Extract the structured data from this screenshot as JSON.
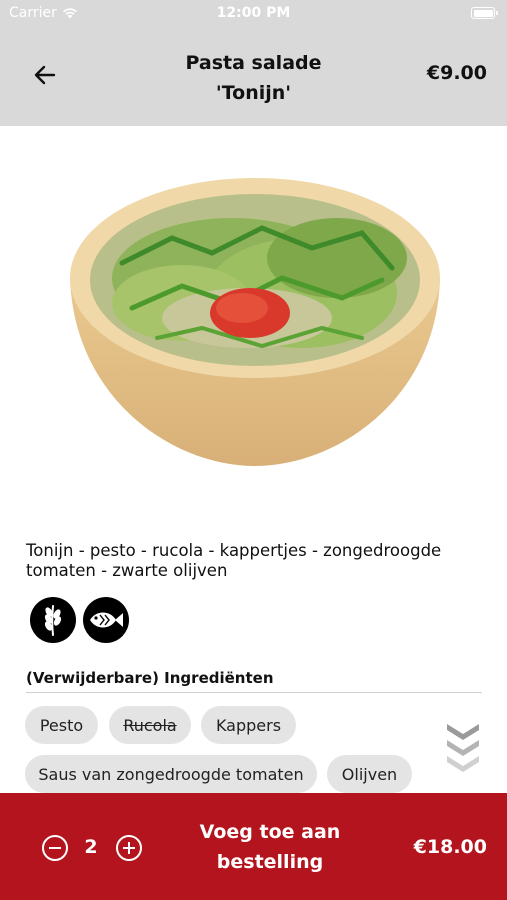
{
  "status_bar": {
    "carrier": "Carrier",
    "time": "12:00 PM"
  },
  "header": {
    "title_line1": "Pasta salade",
    "title_line2": "'Tonijn'",
    "price": "€9.00"
  },
  "product": {
    "description": "Tonijn - pesto - rucola - kappertjes - zongedroogde tomaten - zwarte olijven",
    "badges": [
      "wheat-icon",
      "fish-icon"
    ]
  },
  "ingredients": {
    "title": "(Verwijderbare) Ingrediënten",
    "items": [
      {
        "label": "Pesto",
        "removed": false
      },
      {
        "label": "Rucola",
        "removed": true
      },
      {
        "label": "Kappers",
        "removed": false
      },
      {
        "label": "Saus van zongedroogde tomaten",
        "removed": false
      },
      {
        "label": "Olijven",
        "removed": false
      }
    ]
  },
  "footer": {
    "quantity": "2",
    "add_line1": "Voeg toe aan",
    "add_line2": "bestelling",
    "total": "€18.00"
  },
  "colors": {
    "header_bg": "#d9d9d9",
    "footer_bg": "#b3141d",
    "chip_bg": "#e4e4e4"
  }
}
